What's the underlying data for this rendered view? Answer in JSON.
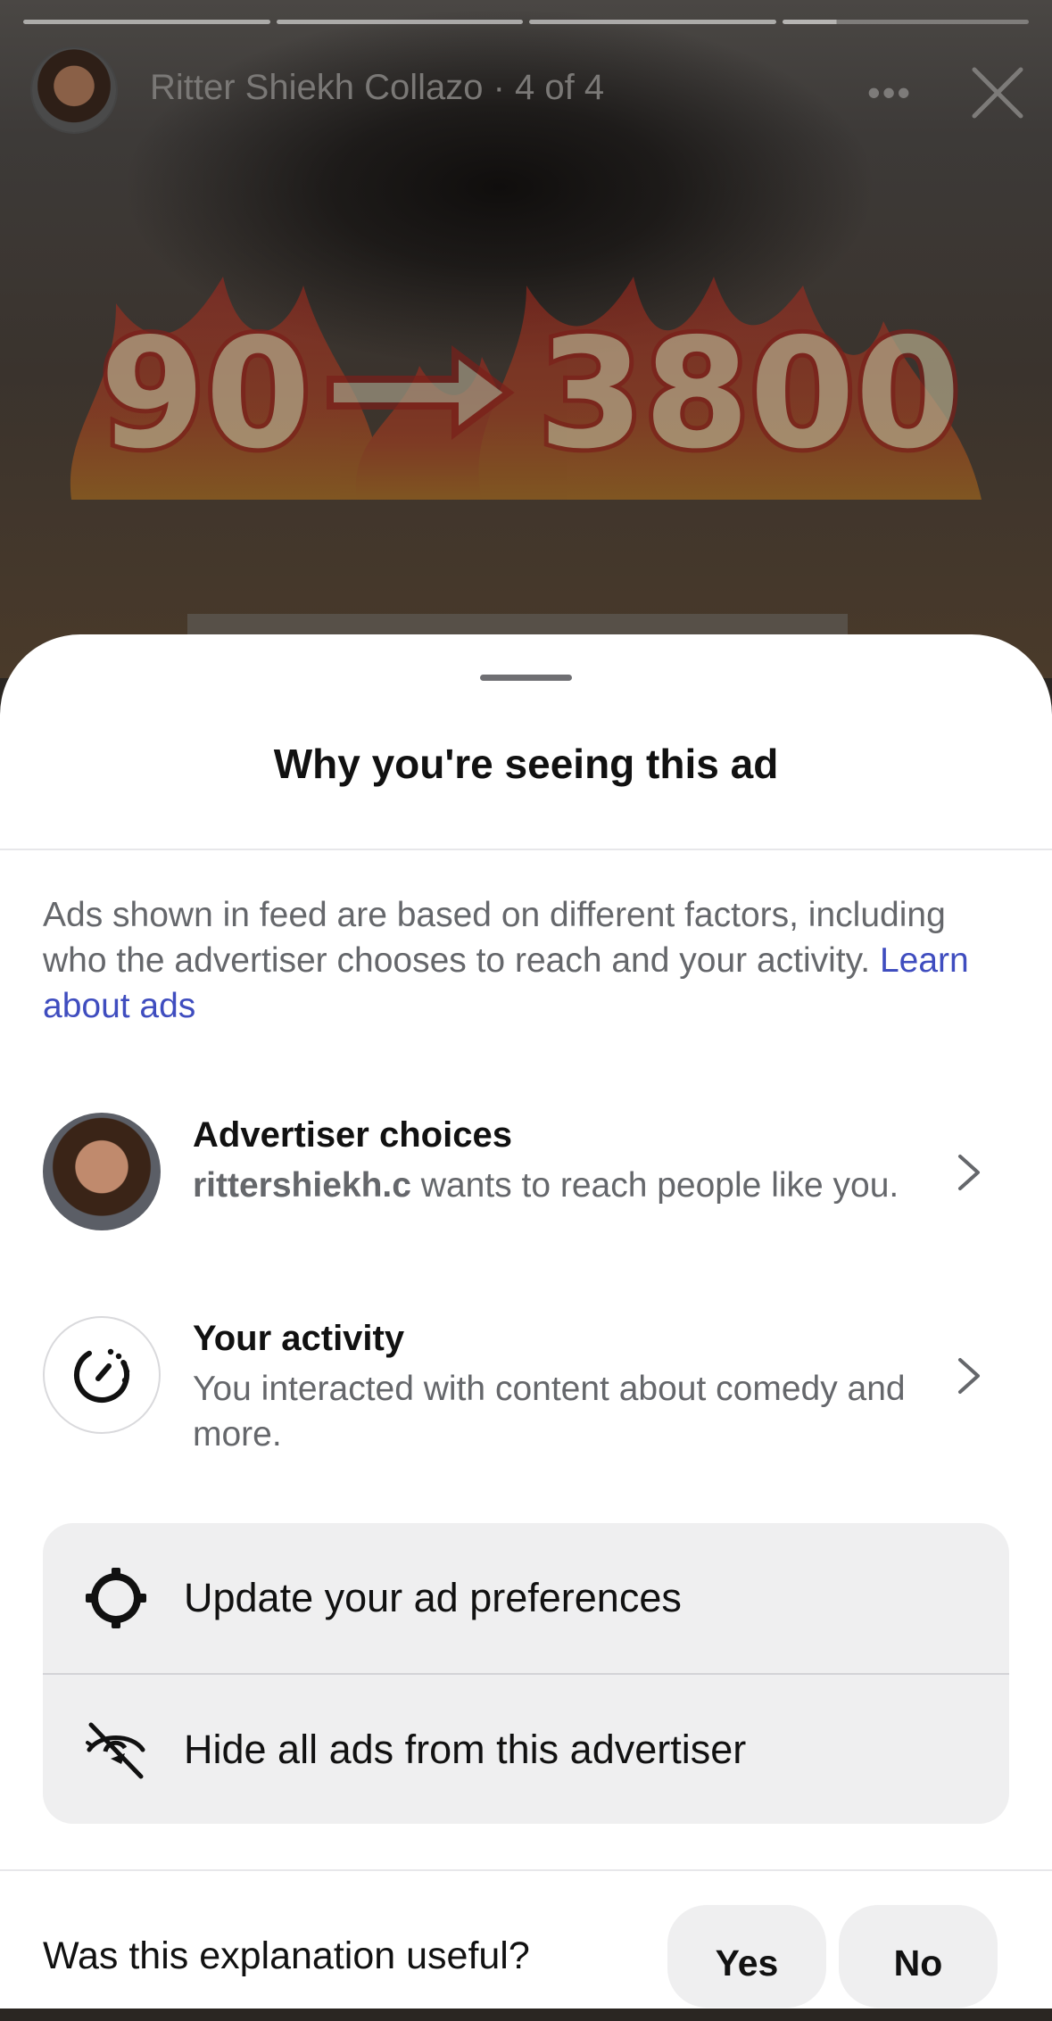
{
  "story": {
    "title": "Ritter Shiekh Collazo · 4 of 4",
    "progress": {
      "current_segment": 4,
      "total_segments": 4
    },
    "ad_graphic_text": {
      "from": "90",
      "to": "3800"
    },
    "more_label": "•••"
  },
  "sheet": {
    "title": "Why you're seeing this ad",
    "intro": "Ads shown in feed are based on different factors, including who the advertiser chooses to reach and your activity. ",
    "learn_link": "Learn about ads",
    "advertiser": {
      "label": "Advertiser choices",
      "handle": "rittershiekh.c",
      "desc": " wants to reach people like you."
    },
    "activity": {
      "label": "Your activity",
      "desc": "You interacted with content about comedy and more."
    },
    "actions": {
      "preferences": "Update your ad preferences",
      "hide": "Hide all ads from this advertiser"
    },
    "feedback": {
      "question": "Was this explanation useful?",
      "yes": "Yes",
      "no": "No"
    }
  },
  "colors": {
    "link": "#3f4dbf",
    "muted_text": "#65676b",
    "card_bg": "#efeff0"
  }
}
